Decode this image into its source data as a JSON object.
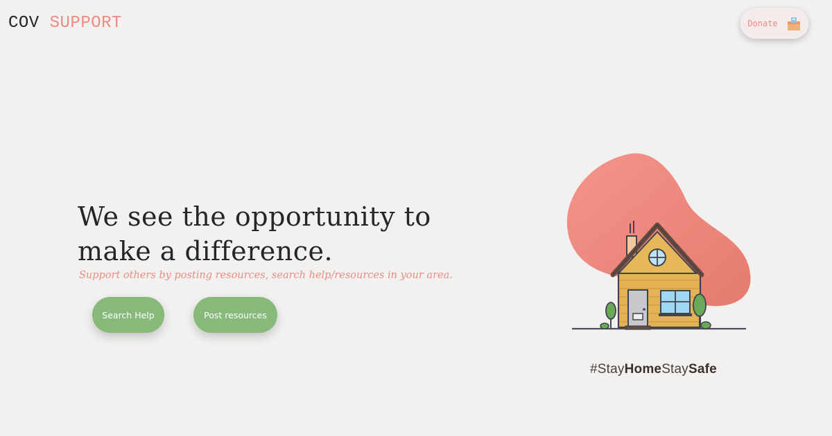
{
  "header": {
    "logo_primary": "COV",
    "logo_accent": "SUPPORT",
    "donate_label": "Donate",
    "donate_icon": "donation-box-icon"
  },
  "hero": {
    "headline_line1": "We see the opportunity to",
    "headline_line2": "make a difference.",
    "subtext": "Support others by posting resources, search help/resources in your area."
  },
  "actions": {
    "search_help_label": "Search Help",
    "post_resources_label": "Post resources"
  },
  "illustration": {
    "icon": "house-icon",
    "hashtag_parts": [
      "#Stay",
      "Home",
      "Stay",
      "Safe"
    ]
  },
  "colors": {
    "background": "#f2f1f0",
    "accent": "#f08a80",
    "button_green": "#86b97a",
    "text_dark": "#262626"
  }
}
